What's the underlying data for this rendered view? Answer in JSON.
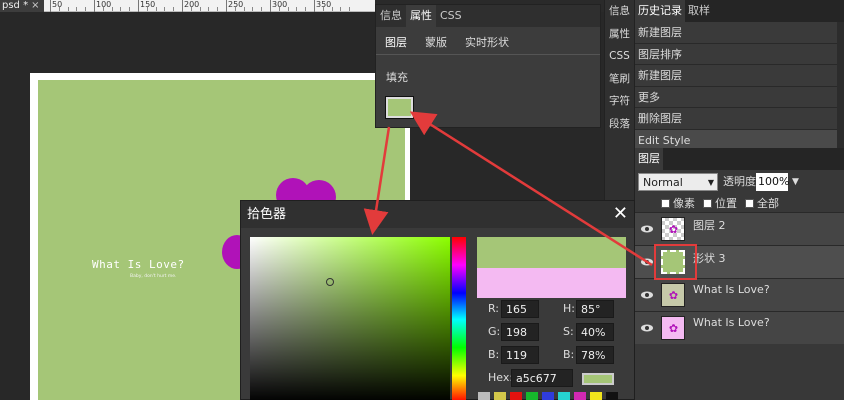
{
  "document": {
    "tab_label": "psd *",
    "close_glyph": "×"
  },
  "ruler": {
    "labels": [
      "0",
      "50",
      "100",
      "150",
      "200",
      "250",
      "300",
      "350"
    ]
  },
  "canvas": {
    "title": "What Is Love?",
    "subtitle": "Baby, don't hurt me."
  },
  "properties": {
    "tabs": [
      "信息",
      "属性",
      "CSS"
    ],
    "active_tab": "属性",
    "sub_tabs": [
      "图层",
      "蒙版",
      "实时形状"
    ],
    "fill_label": "填充",
    "fill_color": "#a5c677"
  },
  "side_bar": {
    "items": [
      "信息",
      "属性",
      "CSS",
      "笔刷",
      "字符",
      "段落"
    ]
  },
  "history": {
    "tabs": [
      "历史记录",
      "取样"
    ],
    "items": [
      "新建图层",
      "图层排序",
      "新建图层",
      "更多",
      "删除图层",
      "Edit Style"
    ]
  },
  "layers": {
    "tab": "图层",
    "blend_mode": "Normal",
    "opacity_label": "透明度:",
    "opacity_value": "100%",
    "locks": [
      "像素",
      "位置",
      "全部"
    ],
    "rows": [
      "图层 2",
      "形状 3",
      "What Is Love?",
      "What Is Love?"
    ]
  },
  "color_picker": {
    "title": "拾色器",
    "close_glyph": "✕",
    "new_color": "#a5c677",
    "old_color": "#f4baf2",
    "r_label": "R:",
    "r_value": "165",
    "g_label": "G:",
    "g_value": "198",
    "b_label": "B:",
    "b_value": "119",
    "h_label": "H:",
    "h_value": "85°",
    "s_label": "S:",
    "s_value": "40%",
    "v_label": "B:",
    "v_value": "78%",
    "hex_label": "Hex:",
    "hex_value": "a5c677",
    "palette": [
      "#bbbbbb",
      "#d4c84a",
      "#e2120f",
      "#16b82c",
      "#2f3cde",
      "#25d3d1",
      "#d429b3",
      "#f1e51c",
      "#111111"
    ]
  },
  "colors": {
    "accent": "#e23b3b",
    "flower": "#b012b8",
    "canvas_green": "#a5c677"
  }
}
